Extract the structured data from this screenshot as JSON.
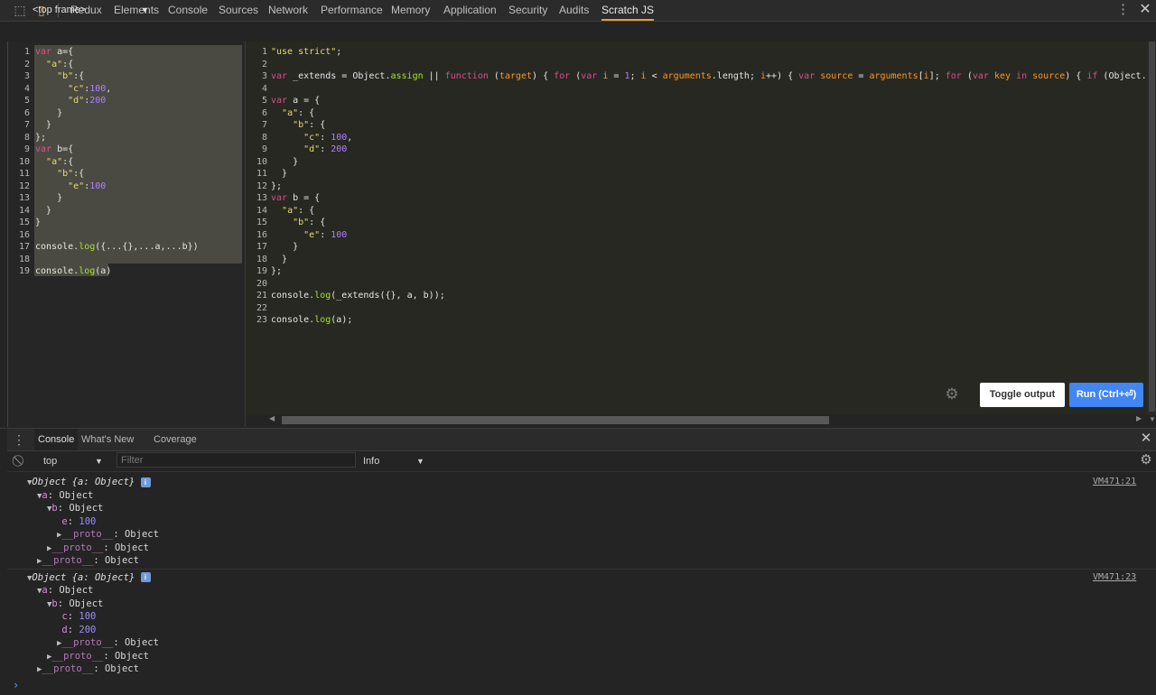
{
  "tabs": [
    "Redux",
    "Elements",
    "Console",
    "Sources",
    "Network",
    "Performance",
    "Memory",
    "Application",
    "Security",
    "Audits",
    "Scratch JS"
  ],
  "active_tab": "Scratch JS",
  "frame_selector": "<top frame>",
  "left_editor": {
    "lines": [
      "var a={",
      "  \"a\":{",
      "    \"b\":{",
      "      \"c\":100,",
      "      \"d\":200",
      "    }",
      "  }",
      "};",
      "var b={",
      "  \"a\":{",
      "    \"b\":{",
      "      \"e\":100",
      "    }",
      "  }",
      "}",
      "",
      "console.log({...{},...a,...b})",
      "",
      "console.log(a)"
    ]
  },
  "right_editor": {
    "lines": [
      "\"use strict\";",
      "",
      "var _extends = Object.assign || function (target) { for (var i = 1; i < arguments.length; i++) { var source = arguments[i]; for (var key in source) { if (Object.proto",
      "",
      "var a = {",
      "  \"a\": {",
      "    \"b\": {",
      "      \"c\": 100,",
      "      \"d\": 200",
      "    }",
      "  }",
      "};",
      "var b = {",
      "  \"a\": {",
      "    \"b\": {",
      "      \"e\": 100",
      "    }",
      "  }",
      "};",
      "",
      "console.log(_extends({}, a, b));",
      "",
      "console.log(a);"
    ]
  },
  "buttons": {
    "toggle_output": "Toggle output",
    "run": "Run (Ctrl+⏎)"
  },
  "drawer_tabs": [
    "Console",
    "What's New",
    "Coverage"
  ],
  "console_toolbar": {
    "context": "top",
    "filter_placeholder": "Filter",
    "level": "Info"
  },
  "console_entries": [
    {
      "header": "Object {a: Object}",
      "source": "VM471:21",
      "rows": [
        {
          "indent": 1,
          "arrow": "▼",
          "key": "a",
          "value": "Object"
        },
        {
          "indent": 2,
          "arrow": "▼",
          "key": "b",
          "value": "Object"
        },
        {
          "indent": 3,
          "arrow": "",
          "key": "e",
          "value": "100"
        },
        {
          "indent": 3,
          "arrow": "▶",
          "key": "__proto__",
          "value": "Object"
        },
        {
          "indent": 2,
          "arrow": "▶",
          "key": "__proto__",
          "value": "Object"
        },
        {
          "indent": 1,
          "arrow": "▶",
          "key": "__proto__",
          "value": "Object"
        }
      ]
    },
    {
      "header": "Object {a: Object}",
      "source": "VM471:23",
      "rows": [
        {
          "indent": 1,
          "arrow": "▼",
          "key": "a",
          "value": "Object"
        },
        {
          "indent": 2,
          "arrow": "▼",
          "key": "b",
          "value": "Object"
        },
        {
          "indent": 3,
          "arrow": "",
          "key": "c",
          "value": "100"
        },
        {
          "indent": 3,
          "arrow": "",
          "key": "d",
          "value": "200"
        },
        {
          "indent": 3,
          "arrow": "▶",
          "key": "__proto__",
          "value": "Object"
        },
        {
          "indent": 2,
          "arrow": "▶",
          "key": "__proto__",
          "value": "Object"
        },
        {
          "indent": 1,
          "arrow": "▶",
          "key": "__proto__",
          "value": "Object"
        }
      ]
    }
  ],
  "prompt_symbol": "›"
}
